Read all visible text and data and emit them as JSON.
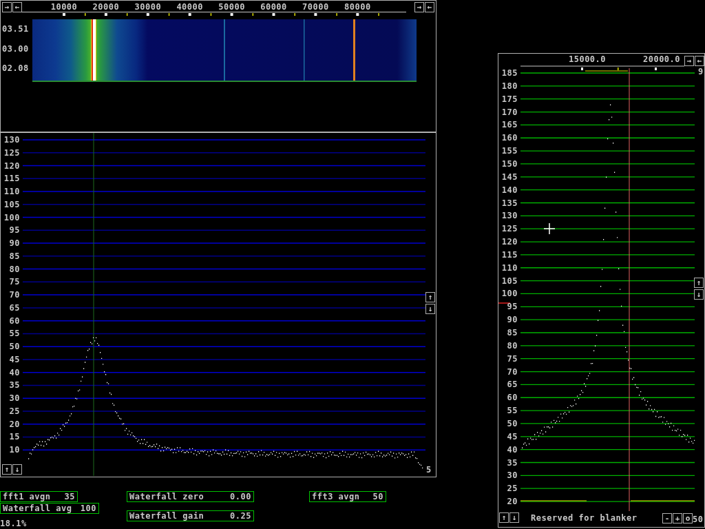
{
  "waterfall_window": {
    "left_buttons": [
      "→",
      "←"
    ],
    "right_buttons": [
      "→",
      "←"
    ],
    "freq_labels": [
      "10000",
      "20000",
      "30000",
      "40000",
      "50000",
      "60000",
      "70000",
      "80000"
    ],
    "time_labels": [
      "03.51",
      "03.00",
      "02.08"
    ]
  },
  "spectrum_window": {
    "y_labels": [
      "130",
      "125",
      "120",
      "115",
      "110",
      "105",
      "100",
      "95",
      "90",
      "85",
      "80",
      "75",
      "70",
      "65",
      "60",
      "55",
      "50",
      "45",
      "40",
      "35",
      "30",
      "25",
      "20",
      "15",
      "10"
    ],
    "side_buttons": [
      "↑",
      "↓"
    ],
    "corner_buttons": [
      "↑",
      "↓"
    ],
    "corner_value": "5"
  },
  "parameters": [
    {
      "label": "fft1 avgn",
      "value": "35"
    },
    {
      "label": "Waterfall avg",
      "value": "100"
    },
    {
      "label": "Waterfall zero",
      "value": "0.00"
    },
    {
      "label": "Waterfall gain",
      "value": "0.25"
    },
    {
      "label": "fft3 avgn",
      "value": "50"
    }
  ],
  "status": "18.1%",
  "baseband_window": {
    "freq_labels": [
      "15000.0",
      "20000.0"
    ],
    "buttons": [
      "→",
      "←"
    ],
    "top_value": "9",
    "y_labels": [
      "185",
      "180",
      "175",
      "170",
      "165",
      "160",
      "155",
      "150",
      "145",
      "140",
      "135",
      "130",
      "125",
      "120",
      "115",
      "110",
      "105",
      "100",
      "95",
      "90",
      "85",
      "80",
      "75",
      "70",
      "65",
      "60",
      "55",
      "50",
      "45",
      "40",
      "35",
      "30",
      "25",
      "20"
    ],
    "side_buttons": [
      "↑",
      "↓"
    ],
    "corner_buttons": [
      "↑",
      "↓"
    ],
    "message": "Reserved for blanker",
    "gain_buttons": [
      "-",
      "+",
      "o"
    ],
    "gain_value": "50"
  }
}
